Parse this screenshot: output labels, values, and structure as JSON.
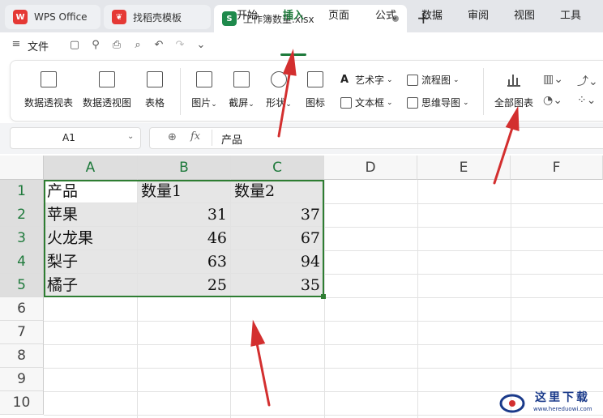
{
  "tabs": {
    "wps": "WPS Office",
    "template": "找稻壳模板",
    "file": "工作簿数量.xlsx",
    "file_icon": "S"
  },
  "menu": {
    "file": "文件",
    "items": [
      "开始",
      "插入",
      "页面",
      "公式",
      "数据",
      "审阅",
      "视图",
      "工具"
    ],
    "active": "插入"
  },
  "ribbon": {
    "pivot_table": "数据透视表",
    "pivot_chart": "数据透视图",
    "table": "表格",
    "picture": "图片",
    "screenshot": "截屏",
    "shape": "形状",
    "icon": "图标",
    "wordart": "艺术字",
    "textbox": "文本框",
    "flowchart": "流程图",
    "mindmap": "思维导图",
    "all_charts": "全部图表"
  },
  "formula": {
    "cell_ref": "A1",
    "fx": "fx",
    "content": "产品"
  },
  "sheet": {
    "columns": [
      "A",
      "B",
      "C",
      "D",
      "E",
      "F"
    ],
    "rows": [
      "1",
      "2",
      "3",
      "4",
      "5",
      "6",
      "7",
      "8",
      "9",
      "10"
    ],
    "header": [
      "产品",
      "数量1",
      "数量2"
    ],
    "data": [
      [
        "苹果",
        "31",
        "37"
      ],
      [
        "火龙果",
        "46",
        "67"
      ],
      [
        "梨子",
        "63",
        "94"
      ],
      [
        "橘子",
        "25",
        "35"
      ]
    ]
  },
  "watermark": {
    "text": "这里下载",
    "url": "www.hereduowi.com"
  },
  "colors": {
    "accent": "#1f7a3c",
    "arrow": "#d32f2f",
    "selection": "#2e7d32"
  }
}
